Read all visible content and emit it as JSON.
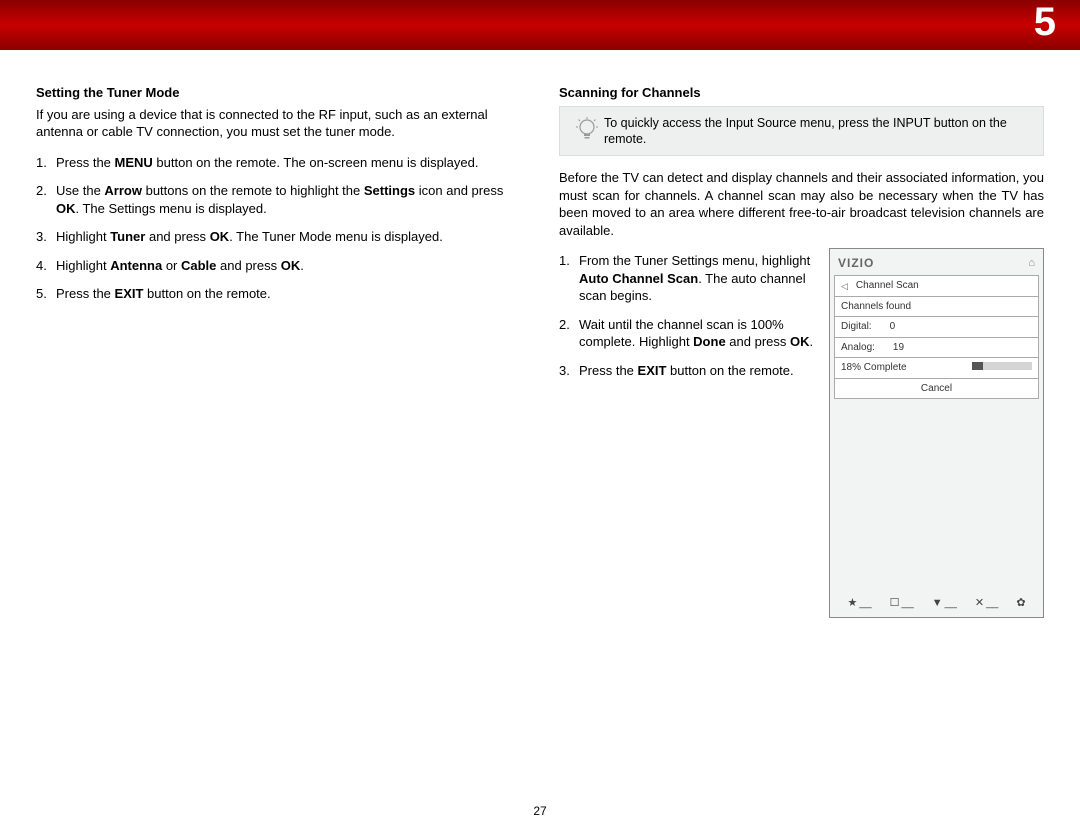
{
  "page": {
    "chapter_number": "5",
    "footer": "27"
  },
  "left": {
    "heading": "Setting the Tuner Mode",
    "intro": "If you are using a device that is connected to the RF input, such as an external antenna or cable TV connection, you must set the tuner mode.",
    "steps": {
      "s1a": "Press the ",
      "s1b": "MENU",
      "s1c": " button on the remote. The on-screen menu is displayed.",
      "s2a": "Use the ",
      "s2b": "Arrow",
      "s2c": " buttons on the remote to highlight the ",
      "s2d": "Settings",
      "s2e": " icon and press ",
      "s2f": "OK",
      "s2g": ". The Settings menu is displayed.",
      "s3a": "Highlight ",
      "s3b": "Tuner",
      "s3c": " and press ",
      "s3d": "OK",
      "s3e": ". The Tuner Mode menu is displayed.",
      "s4a": "Highlight ",
      "s4b": "Antenna",
      "s4c": " or ",
      "s4d": "Cable",
      "s4e": " and press ",
      "s4f": "OK",
      "s4g": ".",
      "s5a": "Press the ",
      "s5b": "EXIT",
      "s5c": " button on the remote."
    }
  },
  "right": {
    "heading": "Scanning for Channels",
    "tip": "To quickly access the Input Source menu, press the INPUT button on the remote.",
    "intro": "Before the TV can detect and display channels and their associated information, you must scan for channels. A channel scan may also be necessary when the TV has been moved to an area where different free-to-air broadcast television channels are available.",
    "steps": {
      "s1a": "From the Tuner Settings menu, highlight ",
      "s1b": "Auto Channel Scan",
      "s1c": ". The auto channel scan begins.",
      "s2a": "Wait until the channel scan is 100% complete. Highlight ",
      "s2b": "Done",
      "s2c": " and press ",
      "s2d": "OK",
      "s2e": ".",
      "s3a": "Press the ",
      "s3b": "EXIT",
      "s3c": " button on the remote."
    }
  },
  "osd": {
    "logo": "VIZIO",
    "title": "Channel Scan",
    "channels_found": "Channels found",
    "digital_label": "Digital:",
    "digital_value": "0",
    "analog_label": "Analog:",
    "analog_value": "19",
    "progress_label": "18% Complete",
    "cancel": "Cancel",
    "icons": {
      "home": "⌂",
      "star": "★",
      "cc": "☐",
      "v": "▼",
      "x": "✕",
      "gear": "✿"
    }
  }
}
